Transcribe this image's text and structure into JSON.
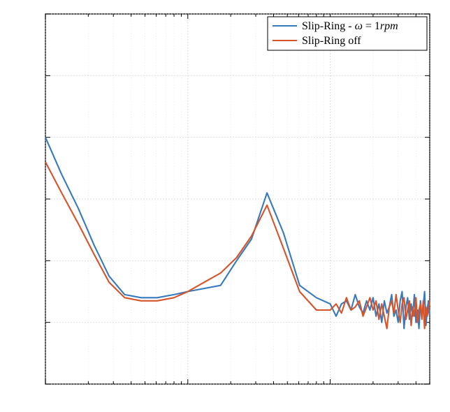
{
  "chart_data": {
    "type": "line",
    "xscale": "log",
    "xlim": [
      1,
      500
    ],
    "ylim": [
      -180,
      -60
    ],
    "xlabel": "",
    "ylabel": "",
    "x_major_ticks": [
      1,
      10,
      100
    ],
    "y_major_ticks": [
      -180,
      -160,
      -140,
      -120,
      -100,
      -80,
      -60
    ],
    "legend_position": "top-right",
    "series": [
      {
        "name": "Slip-Ring - ω = 1rpm",
        "color": "#3679bd",
        "x": [
          1,
          1.3,
          1.7,
          2.2,
          2.8,
          3.6,
          4.7,
          6.1,
          8,
          10,
          13,
          17,
          22,
          28,
          36,
          47,
          61,
          80,
          100,
          110,
          120,
          130,
          140,
          150,
          160,
          170,
          180,
          190,
          200,
          210,
          220,
          230,
          240,
          250,
          260,
          270,
          280,
          290,
          300,
          310,
          320,
          330,
          340,
          350,
          360,
          370,
          380,
          390,
          400,
          410,
          420,
          430,
          440,
          450,
          460,
          470,
          480,
          490,
          500
        ],
        "y": [
          -100,
          -112,
          -123,
          -135,
          -145,
          -151,
          -152,
          -152,
          -151,
          -150,
          -149,
          -148,
          -140,
          -133,
          -118,
          -131,
          -148,
          -152,
          -154,
          -158,
          -154,
          -153,
          -156,
          -151,
          -155,
          -157,
          -153,
          -156,
          -152,
          -158,
          -154,
          -160,
          -153,
          -157,
          -155,
          -151,
          -158,
          -156,
          -160,
          -153,
          -150,
          -162,
          -155,
          -152,
          -159,
          -154,
          -158,
          -151,
          -160,
          -156,
          -162,
          -153,
          -158,
          -155,
          -150,
          -161,
          -156,
          -153,
          -158
        ]
      },
      {
        "name": "Slip-Ring off",
        "color": "#d6542a",
        "x": [
          1,
          1.3,
          1.7,
          2.2,
          2.8,
          3.6,
          4.7,
          6.1,
          8,
          10,
          13,
          17,
          22,
          28,
          36,
          47,
          61,
          80,
          100,
          110,
          120,
          130,
          140,
          150,
          160,
          170,
          180,
          190,
          200,
          210,
          220,
          230,
          240,
          250,
          260,
          270,
          280,
          290,
          300,
          310,
          320,
          330,
          340,
          350,
          360,
          370,
          380,
          390,
          400,
          410,
          420,
          430,
          440,
          450,
          460,
          470,
          480,
          490,
          500
        ],
        "y": [
          -108,
          -118,
          -128,
          -138,
          -147,
          -152,
          -153,
          -153,
          -152,
          -150,
          -147,
          -144,
          -139,
          -132,
          -122,
          -136,
          -150,
          -156,
          -156,
          -154,
          -157,
          -152,
          -156,
          -155,
          -153,
          -158,
          -155,
          -152,
          -156,
          -153,
          -159,
          -154,
          -158,
          -162,
          -155,
          -153,
          -157,
          -151,
          -156,
          -160,
          -154,
          -152,
          -159,
          -156,
          -153,
          -161,
          -155,
          -158,
          -152,
          -160,
          -156,
          -154,
          -159,
          -153,
          -162,
          -155,
          -158,
          -156,
          -153
        ]
      }
    ]
  },
  "legend": {
    "items": [
      {
        "label_pre": "Slip-Ring - ",
        "omega": "ω",
        "label_post": " = 1",
        "unit": "rpm"
      },
      {
        "label_pre": "Slip-Ring off",
        "omega": "",
        "label_post": "",
        "unit": ""
      }
    ]
  }
}
